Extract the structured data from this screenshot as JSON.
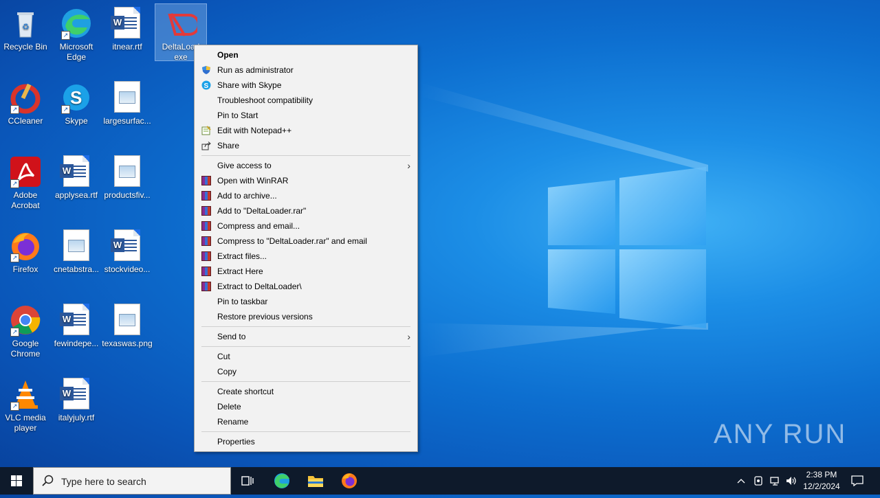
{
  "desktop": {
    "icons": [
      {
        "label": "Recycle Bin"
      },
      {
        "label": "Microsoft Edge"
      },
      {
        "label": "itnear.rtf"
      },
      {
        "label": "DeltaLoad exe"
      },
      {
        "label": "CCleaner"
      },
      {
        "label": "Skype"
      },
      {
        "label": "largesurfac..."
      },
      {
        "label": "Adobe Acrobat"
      },
      {
        "label": "applysea.rtf"
      },
      {
        "label": "productsfiv..."
      },
      {
        "label": "Firefox"
      },
      {
        "label": "cnetabstra..."
      },
      {
        "label": "stockvideo..."
      },
      {
        "label": "Google Chrome"
      },
      {
        "label": "fewindepe..."
      },
      {
        "label": "texaswas.png"
      },
      {
        "label": "VLC media player"
      },
      {
        "label": "italyjuly.rtf"
      }
    ]
  },
  "context_menu": {
    "items": [
      {
        "label": "Open"
      },
      {
        "label": "Run as administrator"
      },
      {
        "label": "Share with Skype"
      },
      {
        "label": "Troubleshoot compatibility"
      },
      {
        "label": "Pin to Start"
      },
      {
        "label": "Edit with Notepad++"
      },
      {
        "label": "Share"
      },
      {
        "label": "Give access to"
      },
      {
        "label": "Open with WinRAR"
      },
      {
        "label": "Add to archive..."
      },
      {
        "label": "Add to \"DeltaLoader.rar\""
      },
      {
        "label": "Compress and email..."
      },
      {
        "label": "Compress to \"DeltaLoader.rar\" and email"
      },
      {
        "label": "Extract files..."
      },
      {
        "label": "Extract Here"
      },
      {
        "label": "Extract to DeltaLoader\\"
      },
      {
        "label": "Pin to taskbar"
      },
      {
        "label": "Restore previous versions"
      },
      {
        "label": "Send to"
      },
      {
        "label": "Cut"
      },
      {
        "label": "Copy"
      },
      {
        "label": "Create shortcut"
      },
      {
        "label": "Delete"
      },
      {
        "label": "Rename"
      },
      {
        "label": "Properties"
      }
    ]
  },
  "taskbar": {
    "search_placeholder": "Type here to search",
    "time": "2:38 PM",
    "date": "12/2/2024"
  },
  "watermark": "ANY RUN"
}
